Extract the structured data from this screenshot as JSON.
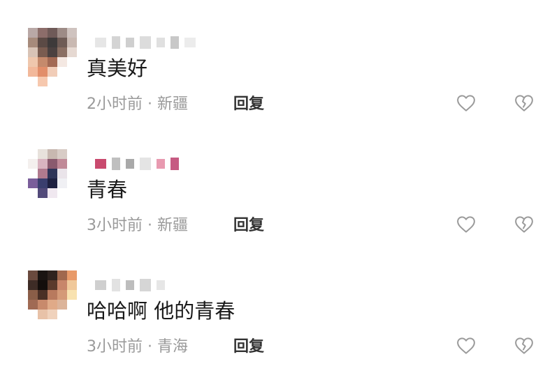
{
  "comments": [
    {
      "text": "真美好",
      "meta": "2小时前 · 新疆",
      "reply_label": "回复",
      "avatar_colors": [
        "#b9a8a6",
        "#8c6d6a",
        "#6f5a58",
        "#9d8b86",
        "#cfc3bf",
        "#a68a7b",
        "#5b4a45",
        "#3e3a3a",
        "#6e5b55",
        "#c9b9b2",
        "#d8c3b6",
        "#7a5c50",
        "#4b4140",
        "#8a6f63",
        "#e6d9d2",
        "#efc7ad",
        "#c58a6c",
        "#a36a54",
        "#f4e8e2",
        "#ffffff",
        "#f2b89a",
        "#e28e6a",
        "#f1cdb8",
        "#ffffff",
        "#ffffff",
        "#ffffff",
        "#f6c8ae",
        "#ffffff",
        "#ffffff",
        "#ffffff"
      ],
      "username_colors": [
        "#e6e6e6",
        "#d4d4d4",
        "#cfcfcf",
        "#dcdcdc",
        "#e0e0e0",
        "#c8c8c8",
        "#ececec"
      ]
    },
    {
      "text": "青春",
      "meta": "3小时前 · 新疆",
      "reply_label": "回复",
      "avatar_colors": [
        "#ffffff",
        "#e8e2dc",
        "#c8b8b0",
        "#d8ccc6",
        "#ffffff",
        "#f4f0ee",
        "#d9b4c0",
        "#8a5a6e",
        "#c08a98",
        "#ffffff",
        "#ffffff",
        "#b07a8e",
        "#2e3458",
        "#eae4ea",
        "#ffffff",
        "#7a5e9a",
        "#3a3e6e",
        "#1e2040",
        "#f0f0f4",
        "#ffffff",
        "#ffffff",
        "#524a7a",
        "#f0e8f0",
        "#ffffff",
        "#ffffff",
        "#ffffff",
        "#ffffff",
        "#ffffff",
        "#ffffff",
        "#ffffff"
      ],
      "username_colors": [
        "#c94a6e",
        "#bfbfbf",
        "#a9a9a9",
        "#e4e4e4",
        "#e89ab0",
        "#c65a82"
      ]
    },
    {
      "text": "哈哈啊 他的青春",
      "meta": "3小时前 · 青海",
      "reply_label": "回复",
      "avatar_colors": [
        "#6a4a3e",
        "#1a1412",
        "#2e221e",
        "#a0684e",
        "#e89a6a",
        "#3e2c26",
        "#140e0c",
        "#5a3a2c",
        "#c8866a",
        "#f0c89a",
        "#8a5e48",
        "#4a3026",
        "#b87a5e",
        "#d49a78",
        "#f8e2b0",
        "#a06a54",
        "#c88a6c",
        "#e0aa88",
        "#dcb49a",
        "#ffffff",
        "#ffffff",
        "#e8c2a8",
        "#f0d2bc",
        "#ffffff",
        "#ffffff",
        "#ffffff",
        "#ffffff",
        "#ffffff",
        "#ffffff",
        "#ffffff"
      ],
      "username_colors": [
        "#cfcfcf",
        "#e2e2e2",
        "#bdbdbd",
        "#d6d6d6",
        "#e6e6e6"
      ]
    }
  ],
  "icons": {
    "like": "heart-outline-icon",
    "dislike": "broken-heart-icon"
  }
}
